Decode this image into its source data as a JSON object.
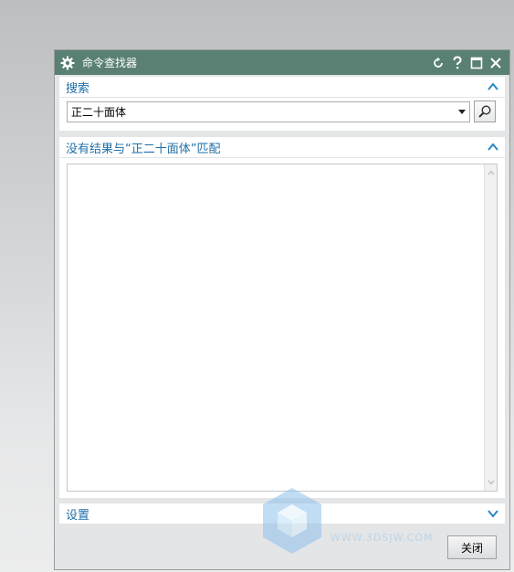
{
  "window": {
    "title": "命令查找器",
    "icons": [
      "gear-icon",
      "reset-icon",
      "help-icon",
      "maximize-icon",
      "close-icon"
    ]
  },
  "search_section": {
    "title": "搜索",
    "query_value": "正二十面体"
  },
  "results_section": {
    "title": "没有结果与“正二十面体”匹配",
    "items": []
  },
  "settings_section": {
    "title": "设置"
  },
  "footer": {
    "close_label": "关闭"
  },
  "watermark": {
    "text": "WWW.3DSJW.COM"
  },
  "colors": {
    "titlebar": "#5a8074",
    "section_text": "#1f6fa8",
    "chevron": "#2a87c7"
  }
}
